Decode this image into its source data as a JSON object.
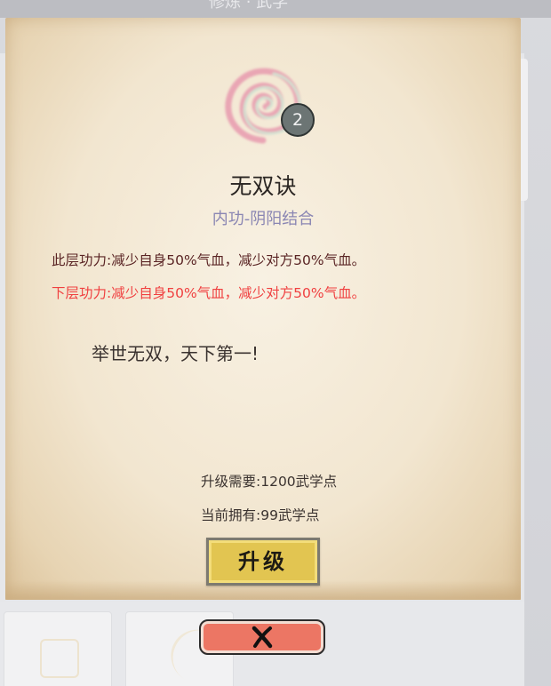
{
  "background": {
    "header_text": "修炼 · 武学"
  },
  "skill": {
    "icon": "swirl-technique-icon",
    "level": "2",
    "name": "无双诀",
    "type": "内功-阴阳结合",
    "current_effect": "此层功力:减少自身50%气血，减少对方50%气血。",
    "next_effect": "下层功力:减少自身50%气血，减少对方50%气血。",
    "motto": "举世无双，天下第一!",
    "upgrade_required": "升级需要:1200武学点",
    "current_owned": "当前拥有:99武学点"
  },
  "buttons": {
    "upgrade_label": "升级",
    "close_icon": "close-icon"
  },
  "colors": {
    "parchment": "#f2e6d0",
    "next_effect": "#f04040",
    "current_effect": "#5a2424",
    "skill_type": "#8a86b3",
    "upgrade_button": "#e2c551",
    "close_button": "#ec7664"
  }
}
